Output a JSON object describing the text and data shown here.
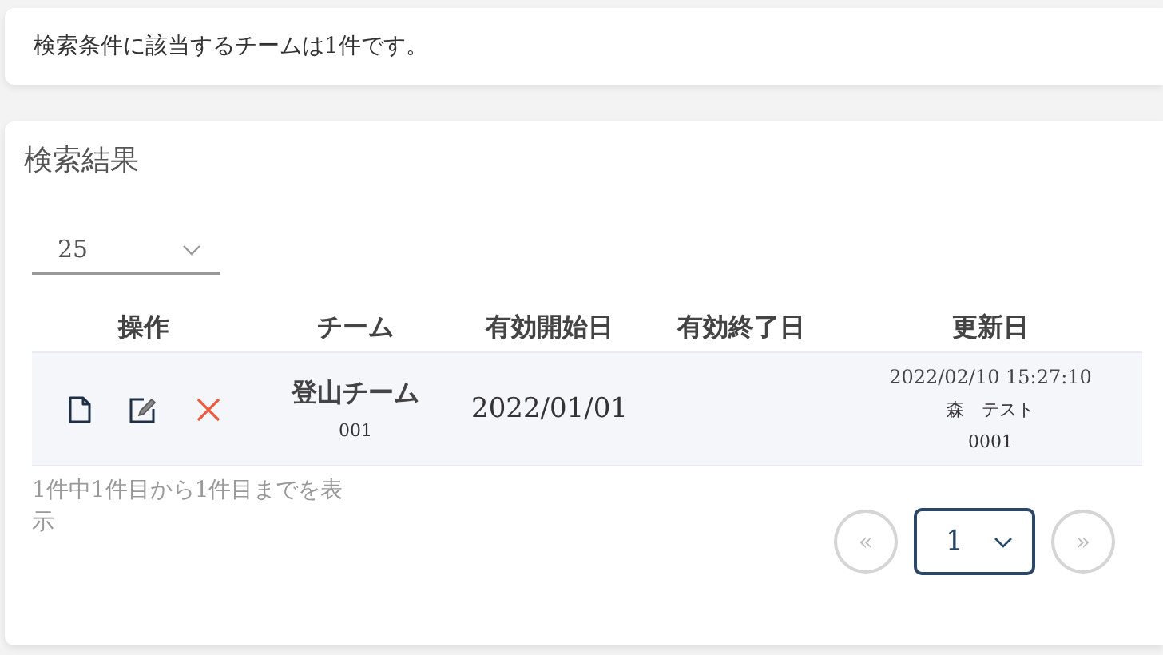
{
  "message": "検索条件に該当するチームは1件です。",
  "results": {
    "title": "検索結果",
    "page_size": {
      "value": "25"
    },
    "columns": [
      "操作",
      "チーム",
      "有効開始日",
      "有効終了日",
      "更新日"
    ],
    "rows": [
      {
        "team_name": "登山チーム",
        "team_code": "001",
        "start_date": "2022/01/01",
        "end_date": "",
        "updated_at": "2022/02/10 15:27:10",
        "updated_by": "森　テスト",
        "updated_by_code": "0001"
      }
    ],
    "summary": "1件中1件目から1件目までを表示",
    "pagination": {
      "prev": "«",
      "page": "1",
      "next": "»"
    }
  }
}
